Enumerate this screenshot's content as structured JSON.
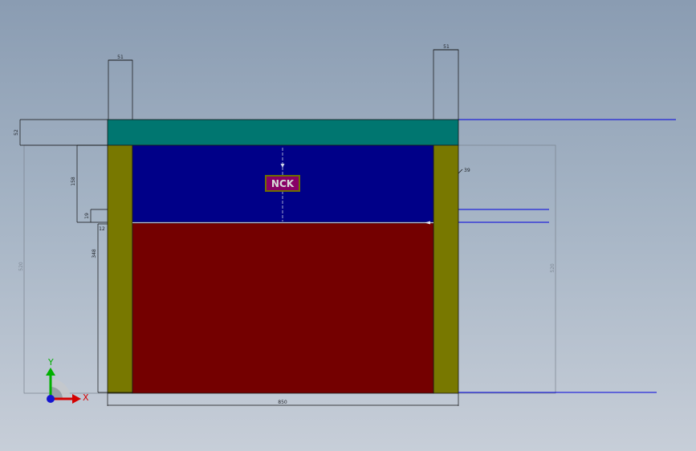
{
  "colors": {
    "top_plate": "#007670",
    "side_wall": "#787800",
    "upper_chamber": "#000088",
    "lower_chamber": "#740000",
    "reference_line": "#0000dd",
    "dimension_line": "#111111",
    "label_fill": "#880066",
    "label_border": "#6e6e00",
    "axis_x": "#d40000",
    "axis_y": "#00b000",
    "axis_z": "#1414d0"
  },
  "part": {
    "label_text": "NCK"
  },
  "dimensions": {
    "top_left_post_width": "51",
    "top_right_post_width": "51",
    "top_plate_height": "52",
    "upper_chamber_height": "158",
    "small_offset_a": "19",
    "small_offset_b": "12",
    "lower_height": "348",
    "overall_height": "520",
    "right_wall_callout": "39",
    "overall_width_bottom": "850",
    "right_overall_height": "520"
  },
  "triad": {
    "x_label": "X",
    "y_label": "Y"
  }
}
